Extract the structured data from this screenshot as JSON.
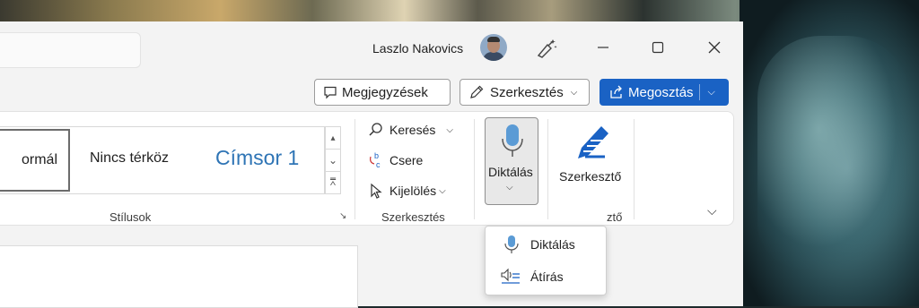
{
  "titlebar": {
    "user_name": "Laszlo Nakovics"
  },
  "toolbar": {
    "comments_label": "Megjegyzések",
    "editing_label": "Szerkesztés",
    "share_label": "Megosztás"
  },
  "ribbon": {
    "styles": {
      "normal_tail": "ormál",
      "no_spacing": "Nincs térköz",
      "heading1": "Címsor 1",
      "group_label": "Stílusok"
    },
    "editing": {
      "find": "Keresés",
      "replace": "Csere",
      "select": "Kijelölés",
      "group_label": "Szerkesztés"
    },
    "voice": {
      "dictate_label": "Diktálás"
    },
    "editor": {
      "editor_label": "Szerkesztő",
      "group_label_visible": "ztő"
    }
  },
  "dictate_menu": {
    "items": [
      {
        "label": "Diktálás",
        "icon": "microphone-icon"
      },
      {
        "label": "Átírás",
        "icon": "transcribe-icon"
      }
    ]
  },
  "colors": {
    "accent": "#1a62c4",
    "heading": "#2e74b5",
    "ribbon_bg": "#ffffff",
    "window_bg": "#f3f3f3"
  }
}
